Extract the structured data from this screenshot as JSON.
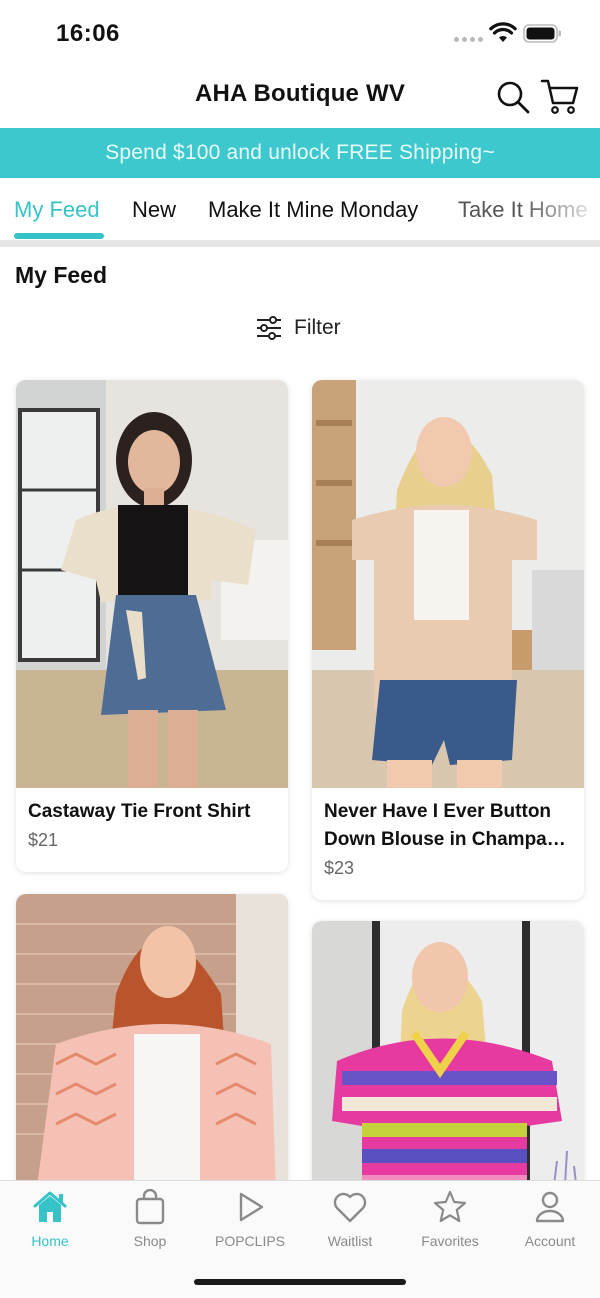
{
  "status_bar": {
    "time": "16:06"
  },
  "header": {
    "title": "AHA Boutique WV",
    "search_icon": "search-icon",
    "cart_icon": "cart-icon"
  },
  "promo": {
    "text": "Spend $100 and unlock FREE Shipping~"
  },
  "tabs": [
    {
      "label": "My Feed",
      "active": true
    },
    {
      "label": "New",
      "active": false
    },
    {
      "label": "Make It Mine Monday",
      "active": false
    },
    {
      "label": "Take It Home",
      "active": false
    }
  ],
  "section": {
    "title": "My Feed",
    "filter_label": "Filter"
  },
  "products": [
    {
      "name": "Castaway Tie Front Shirt",
      "price": "$21"
    },
    {
      "name_line1": "Never Have I Ever Button",
      "name_line2": "Down Blouse in Champa…",
      "price": "$23"
    },
    {
      "name": "",
      "price": ""
    },
    {
      "name": "",
      "price": ""
    }
  ],
  "bottom_nav": [
    {
      "label": "Home",
      "icon": "home-icon",
      "active": true
    },
    {
      "label": "Shop",
      "icon": "bag-icon",
      "active": false
    },
    {
      "label": "POPCLIPS",
      "icon": "play-icon",
      "active": false
    },
    {
      "label": "Waitlist",
      "icon": "heart-icon",
      "active": false
    },
    {
      "label": "Favorites",
      "icon": "star-icon",
      "active": false
    },
    {
      "label": "Account",
      "icon": "person-icon",
      "active": false
    }
  ],
  "colors": {
    "accent": "#35c3c8",
    "banner": "#3cc8cc",
    "nav_inactive": "#8a8a8a"
  }
}
